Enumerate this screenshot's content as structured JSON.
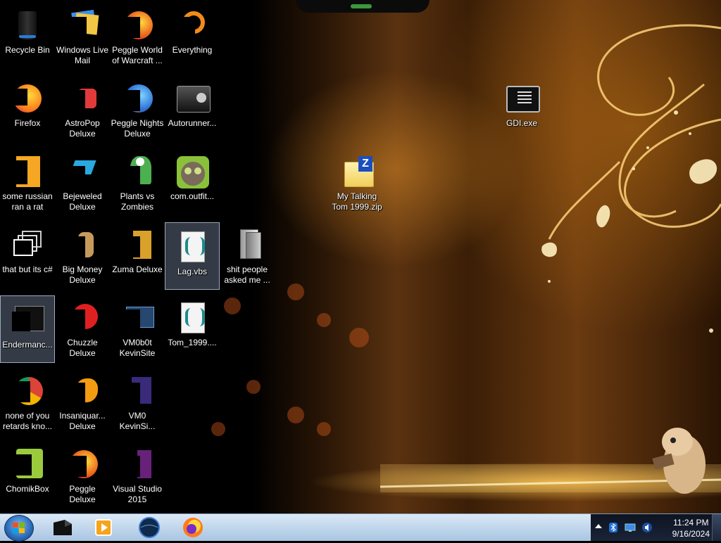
{
  "desktop": {
    "icons": [
      {
        "label": "Recycle Bin",
        "icon": "recycle-bin-icon"
      },
      {
        "label": "Windows Live Mail",
        "icon": "windows-live-mail-icon"
      },
      {
        "label": "Peggle World of Warcraft ...",
        "icon": "peggle-wow-icon"
      },
      {
        "label": "Everything",
        "icon": "everything-icon"
      },
      {
        "label": "Firefox",
        "icon": "firefox-icon"
      },
      {
        "label": "AstroPop Deluxe",
        "icon": "astropop-icon"
      },
      {
        "label": "Peggle Nights Deluxe",
        "icon": "peggle-nights-icon"
      },
      {
        "label": "Autorunner...",
        "icon": "autorunner-icon"
      },
      {
        "label": "some russian ran a rat",
        "icon": "file-icon"
      },
      {
        "label": "Bejeweled Deluxe",
        "icon": "bejeweled-icon"
      },
      {
        "label": "Plants vs Zombies",
        "icon": "plants-vs-zombies-icon"
      },
      {
        "label": "com.outfit...",
        "icon": "talking-tom-icon"
      },
      {
        "label": "that but its c#",
        "icon": "shortcut-windows-icon"
      },
      {
        "label": "Big Money Deluxe",
        "icon": "big-money-icon"
      },
      {
        "label": "Zuma Deluxe",
        "icon": "zuma-icon"
      },
      {
        "label": "Lag.vbs",
        "icon": "vbs-script-icon"
      },
      {
        "label": "shit people asked me ...",
        "icon": "folder-icon"
      },
      {
        "label": "Endermanc...",
        "icon": "app-window-icon"
      },
      {
        "label": "Chuzzle Deluxe",
        "icon": "chuzzle-icon"
      },
      {
        "label": "VM0b0t KevinSite",
        "icon": "vm-icon"
      },
      {
        "label": "Tom_1999....",
        "icon": "vbs-script-icon"
      },
      {
        "label": "none of you retards kno...",
        "icon": "chrome-icon"
      },
      {
        "label": "Insaniquar... Deluxe",
        "icon": "insaniquarium-icon"
      },
      {
        "label": "VM0 KevinSi...",
        "icon": "file-icon"
      },
      {
        "label": "ChomikBox",
        "icon": "chomikbox-icon"
      },
      {
        "label": "Peggle Deluxe",
        "icon": "peggle-icon"
      },
      {
        "label": "Visual Studio 2015",
        "icon": "visual-studio-icon"
      },
      {
        "label": "My Talking Tom 1999.zip",
        "icon": "zip-folder-icon"
      },
      {
        "label": "GDI.exe",
        "icon": "exe-icon"
      }
    ]
  },
  "taskbar": {
    "pinned": [
      "file-explorer-icon",
      "media-player-icon",
      "network-globe-icon",
      "firefox-icon"
    ],
    "tray_icons": [
      "bluetooth-icon",
      "display-icon",
      "speaker-icon"
    ],
    "time": "11:24 PM",
    "date": "9/16/2024"
  },
  "colors": {
    "taskbar": "#bcd3ea",
    "tray": "#1a2438",
    "selection": "#96aac8"
  }
}
